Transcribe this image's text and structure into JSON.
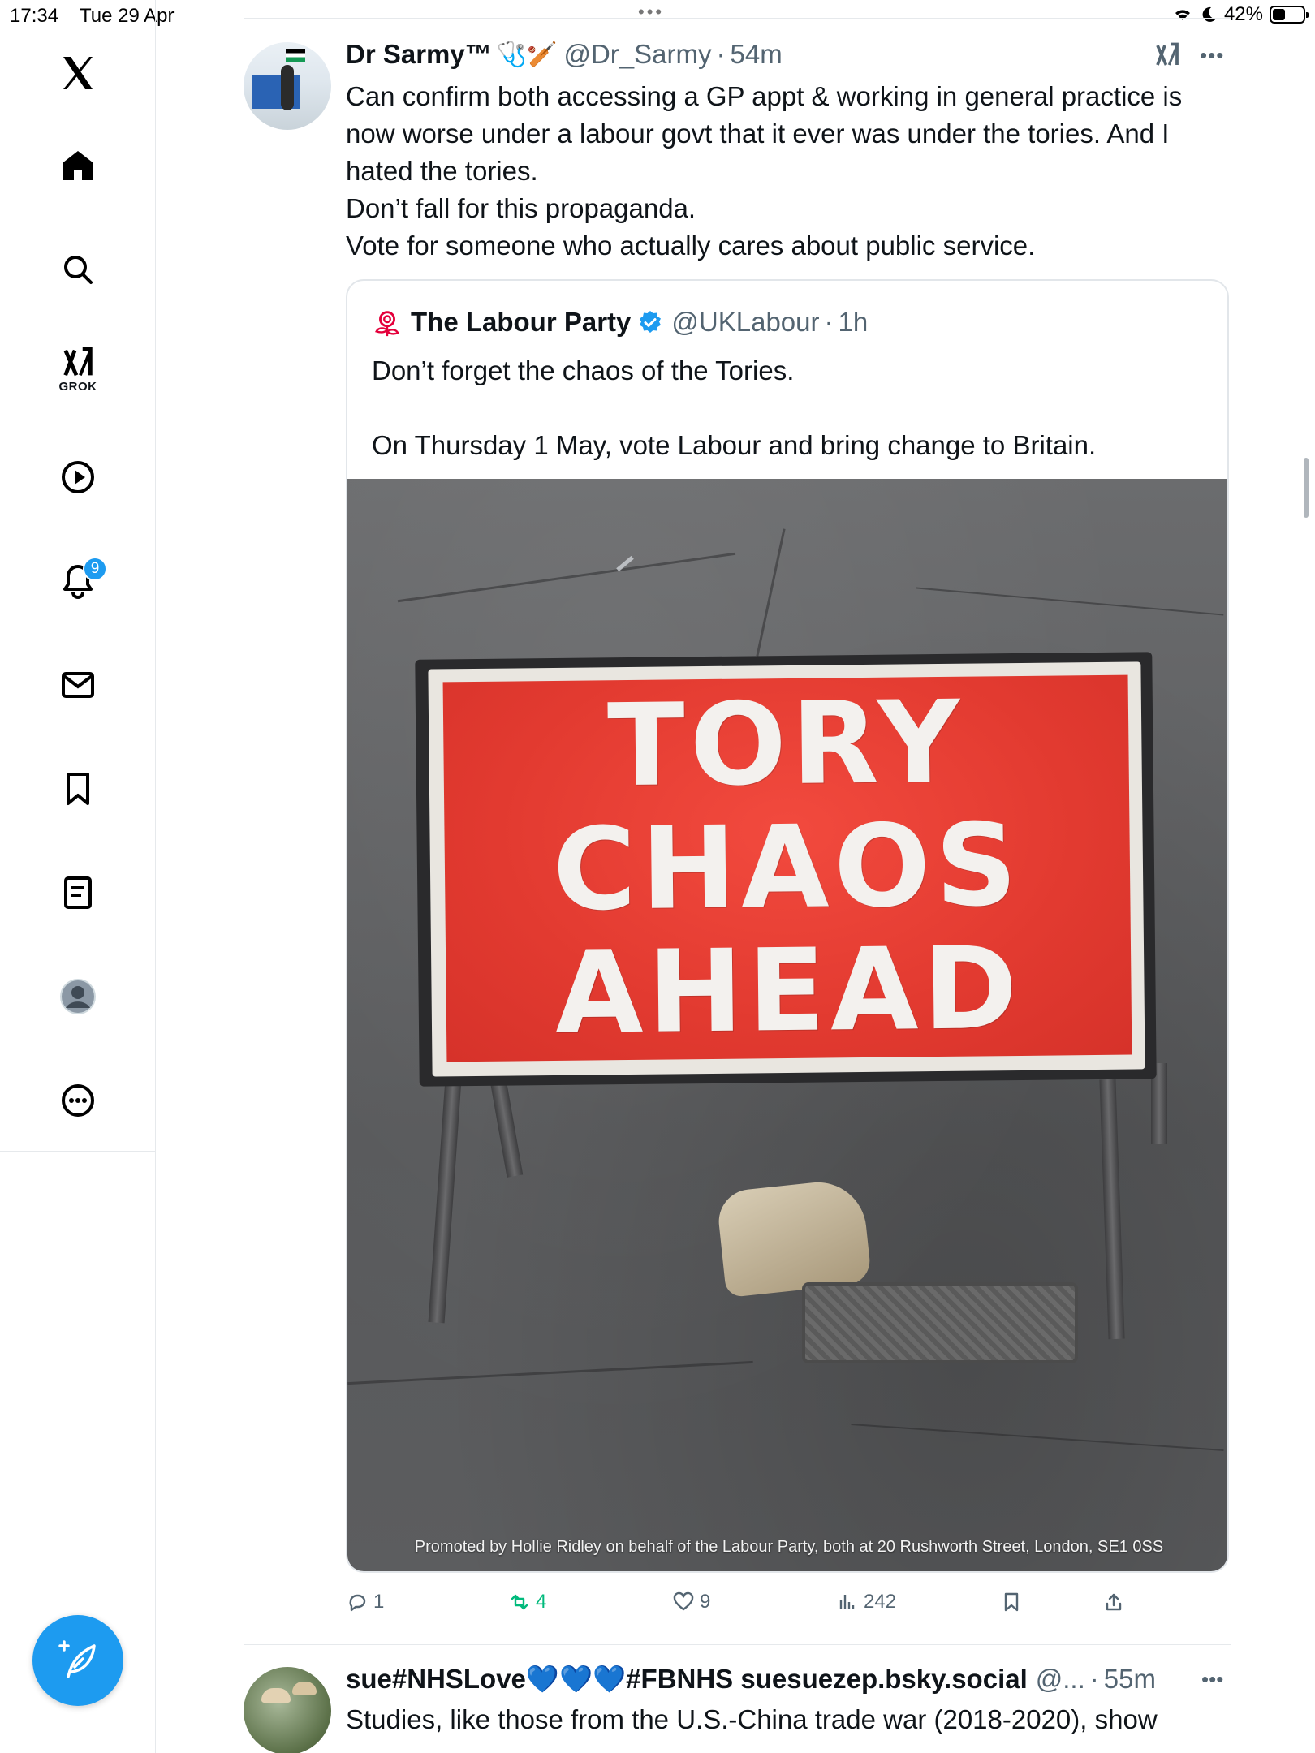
{
  "status_bar": {
    "time": "17:34",
    "date": "Tue 29 Apr",
    "battery": "42%",
    "battery_level": 0.42
  },
  "sidebar": {
    "grok_label": "GROK",
    "notification_count": "9",
    "items": [
      "x-logo",
      "home",
      "search",
      "grok",
      "video",
      "notifications",
      "messages",
      "bookmarks",
      "lists",
      "profile",
      "more"
    ]
  },
  "tweet": {
    "name": "Dr Sarmy™",
    "emoji": "🩺🏏",
    "handle": "@Dr_Sarmy",
    "time": "54m",
    "lines": [
      "Can confirm both accessing a GP appt & working in general practice is",
      "now worse under a labour govt that it ever was under the tories. And I",
      "hated the tories.",
      "Don’t fall for this propaganda.",
      "Vote for someone who actually cares about public service."
    ],
    "quote": {
      "name": "The Labour Party",
      "handle": "@UKLabour",
      "time": "1h",
      "line1": "Don’t forget the chaos of the Tories.",
      "line2": "On Thursday 1 May, vote Labour and bring change to Britain.",
      "image": {
        "sign_lines": [
          "TORY",
          "CHAOS",
          "AHEAD"
        ],
        "caption": "Promoted by Hollie Ridley on behalf of the Labour Party, both at 20 Rushworth Street, London, SE1 0SS"
      }
    },
    "actions": {
      "replies": "1",
      "reposts": "4",
      "likes": "9",
      "views": "242"
    }
  },
  "tweet2": {
    "name": "sue#NHSLove💙💙💙#FBNHS suesuezep.bsky.social",
    "handle": "@...",
    "time": "55m",
    "text": "Studies, like those from the U.S.-China trade war (2018-2020), show"
  },
  "colors": {
    "accent": "#1d9bf0",
    "repost_green": "#00ba7c",
    "muted": "#536471",
    "sign_red": "#e23a30"
  }
}
